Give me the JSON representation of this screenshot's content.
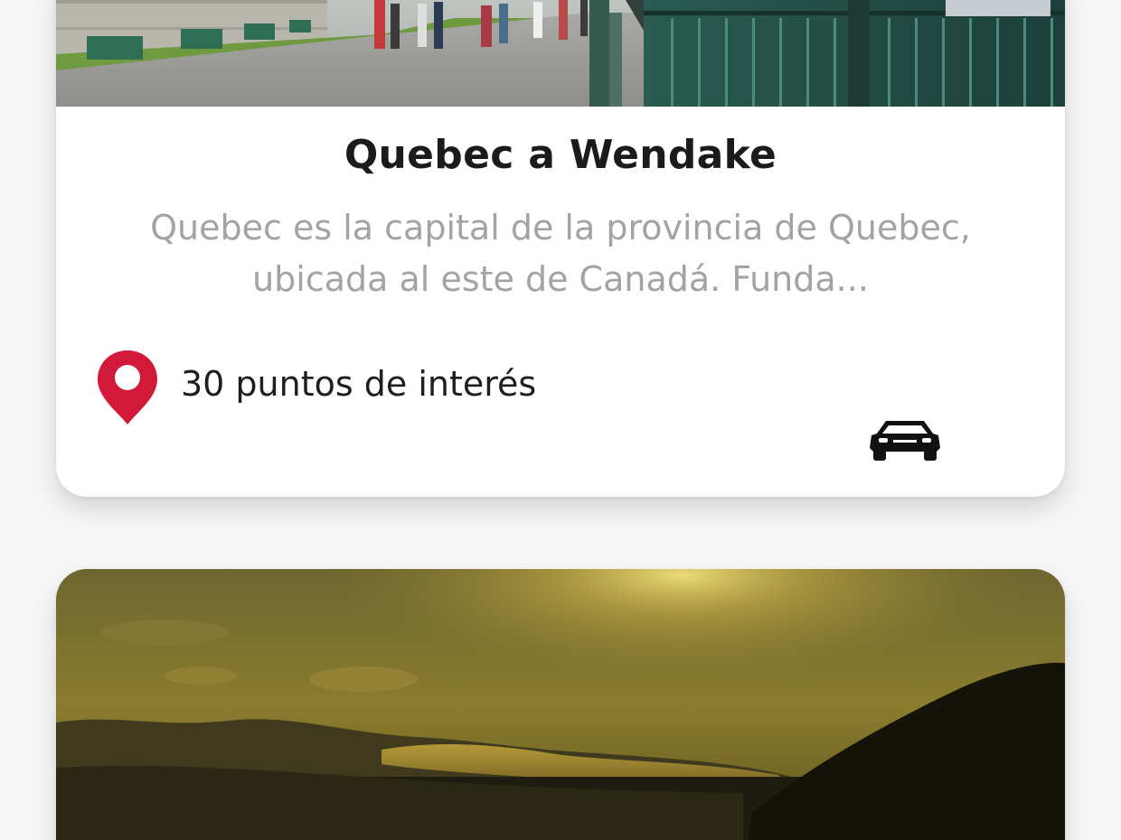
{
  "cards": [
    {
      "image": "quebec-promenade-photo",
      "title": "Quebec a Wendake",
      "description": "Quebec es la capital de la provincia de Quebec, ubicada al este de Canadá. Funda...",
      "poi_icon": "location-pin-icon",
      "poi_text": "30 puntos de interés",
      "transport_icon": "car-icon"
    },
    {
      "image": "sunset-landscape-photo"
    }
  ],
  "colors": {
    "accent": "#d3193a",
    "title": "#1b1b1b",
    "description": "#a3a3a3",
    "background": "#f6f6f6"
  }
}
